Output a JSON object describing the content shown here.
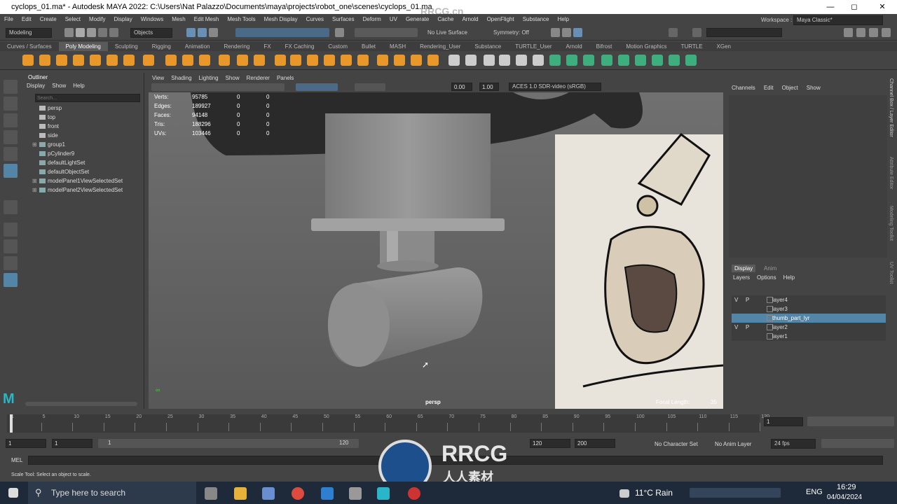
{
  "window": {
    "title": "cyclops_01.ma* - Autodesk MAYA 2022: C:\\Users\\Nat Palazzo\\Documents\\maya\\projects\\robot_one\\scenes\\cyclops_01.ma",
    "watermark": "RRCG.cn"
  },
  "menu": [
    "File",
    "Edit",
    "Create",
    "Select",
    "Modify",
    "Display",
    "Windows",
    "Mesh",
    "Edit Mesh",
    "Mesh Tools",
    "Mesh Display",
    "Curves",
    "Surfaces",
    "Deform",
    "UV",
    "Generate",
    "Cache",
    "Arnold",
    "OpenFlight",
    "Substance",
    "Help"
  ],
  "workspace": {
    "label": "Workspace :",
    "value": "Maya Classic*"
  },
  "statusline": {
    "mode": "Modeling",
    "objects": "Objects",
    "live_surface": "No Live Surface",
    "symmetry": "Symmetry: Off"
  },
  "shelf_tabs": [
    "Curves / Surfaces",
    "Poly Modeling",
    "Sculpting",
    "Rigging",
    "Animation",
    "Rendering",
    "FX",
    "FX Caching",
    "Custom",
    "Bullet",
    "MASH",
    "Rendering_User",
    "Substance",
    "TURTLE_User",
    "Arnold",
    "Bifrost",
    "Motion Graphics",
    "TURTLE",
    "XGen"
  ],
  "shelf_active": "Poly Modeling",
  "outliner": {
    "title": "Outliner",
    "menu": [
      "Display",
      "Show",
      "Help"
    ],
    "search_placeholder": "Search...",
    "items": [
      "persp",
      "top",
      "front",
      "side",
      "group1",
      "pCylinder9",
      "defaultLightSet",
      "defaultObjectSet",
      "modelPanel1ViewSelectedSet",
      "modelPanel2ViewSelectedSet"
    ]
  },
  "viewport": {
    "menu": [
      "View",
      "Shading",
      "Lighting",
      "Show",
      "Renderer",
      "Panels"
    ],
    "exposure": "0.00",
    "gamma": "1.00",
    "colorspace": "ACES 1.0 SDR-video (sRGB)",
    "camera": "persp",
    "focal_label": "Focal Length:",
    "focal_value": "35",
    "stats": [
      {
        "label": "Verts:",
        "a": "95785",
        "b": "0",
        "c": "0"
      },
      {
        "label": "Edges:",
        "a": "189927",
        "b": "0",
        "c": "0"
      },
      {
        "label": "Faces:",
        "a": "94148",
        "b": "0",
        "c": "0"
      },
      {
        "label": "Tris:",
        "a": "188296",
        "b": "0",
        "c": "0"
      },
      {
        "label": "UVs:",
        "a": "103446",
        "b": "0",
        "c": "0"
      }
    ]
  },
  "channelbox": {
    "menu": [
      "Channels",
      "Edit",
      "Object",
      "Show"
    ],
    "side_tabs": [
      "Channel Box / Layer Editor",
      "Attribute Editor",
      "Modeling Toolkit",
      "UV Toolkit"
    ]
  },
  "layers": {
    "tabs": [
      "Display",
      "Anim"
    ],
    "menu": [
      "Layers",
      "Options",
      "Help"
    ],
    "rows": [
      {
        "v": "V",
        "p": "P",
        "name": "layer4"
      },
      {
        "v": "",
        "p": "",
        "name": "layer3"
      },
      {
        "v": "",
        "p": "",
        "name": "thumb_part_lyr"
      },
      {
        "v": "V",
        "p": "P",
        "name": "layer2"
      },
      {
        "v": "",
        "p": "",
        "name": "layer1"
      }
    ],
    "selected": "thumb_part_lyr"
  },
  "timeline": {
    "ticks": [
      "1",
      "5",
      "10",
      "15",
      "20",
      "25",
      "30",
      "35",
      "40",
      "45",
      "50",
      "55",
      "60",
      "65",
      "70",
      "75",
      "80",
      "85",
      "90",
      "95",
      "100",
      "105",
      "110",
      "115",
      "120"
    ],
    "current": "1"
  },
  "range": {
    "start": "1",
    "start2": "1",
    "slider_start": "1",
    "slider_end": "120",
    "end": "120",
    "end2": "200",
    "character": "No Character Set",
    "anim_layer": "No Anim Layer",
    "fps": "24 fps"
  },
  "mel": {
    "label": "MEL"
  },
  "helpline": "Scale Tool: Select an object to scale.",
  "taskbar": {
    "search": "Type here to search",
    "weather": "11°C Rain",
    "lang": "ENG",
    "time": "16:29",
    "date": "04/04/2024"
  },
  "logo": {
    "brand": "RRCG",
    "sub": "人人素材"
  },
  "colors": {
    "accent": "#5285a6",
    "shelf_orange": "#e8972b",
    "shelf_green": "#3fae7e",
    "taskbar": "#1e2a3a"
  }
}
